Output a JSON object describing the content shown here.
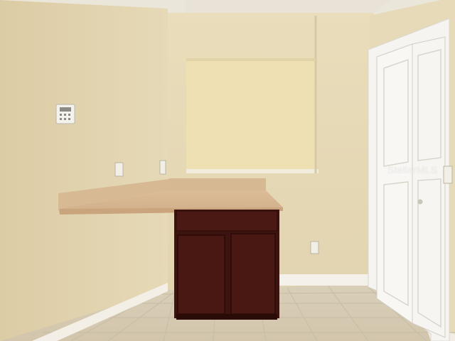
{
  "scene": {
    "description_colors": {
      "left_wall": "#e6d9b7",
      "back_wall": "#e8dcba",
      "ceiling": "#eae5d9",
      "countertop": "#d5b48f",
      "cabinet": "#3f1510",
      "floor_tile": "#d8cdb6",
      "baseboard": "#f4f1ea",
      "closet_door": "#f7f6f3"
    }
  },
  "watermark": {
    "text": "StellarMLS"
  }
}
